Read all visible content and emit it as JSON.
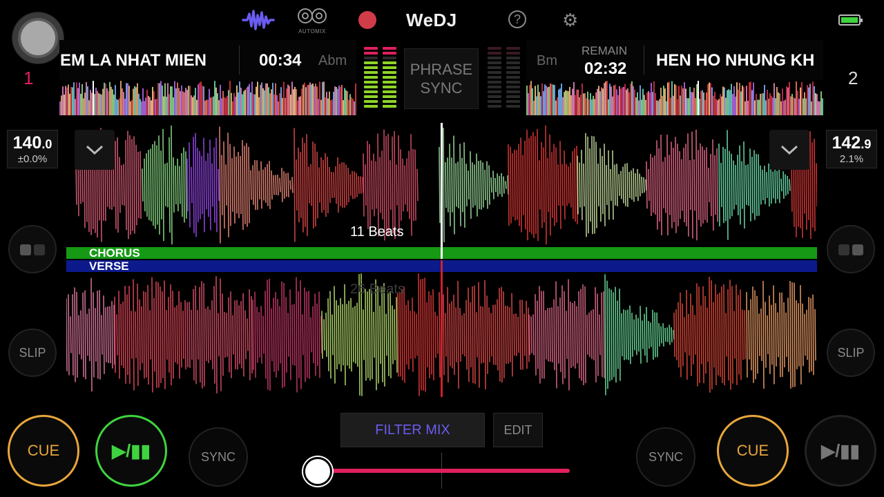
{
  "app": {
    "logo": "WeDJ",
    "automix_label": "AUTOMIX",
    "help_glyph": "?"
  },
  "icons": {
    "waveform": "waveform-icon",
    "automix": "automix-icon",
    "record": "record-icon",
    "help": "help-icon",
    "settings": "gear-icon",
    "battery": "battery-icon",
    "chevron": "chevron-down-icon",
    "split": "split-view-icon"
  },
  "colors": {
    "accent_purple": "#6a5cf0",
    "deck_one": "#e0205c",
    "cue": "#e8a63c",
    "play": "#3fd340",
    "chorus": "#169a16",
    "verse": "#0d1a8c",
    "record": "#d03c48"
  },
  "deck1": {
    "number": "1",
    "title": "EM LA NHAT MIEN",
    "time": "00:34",
    "key": "Abm",
    "bpm_int": "140",
    "bpm_dec": ".0",
    "pitch": "±0.0%",
    "beats": "11 Beats",
    "slip": "SLIP",
    "cue": "CUE",
    "play": "▶/▮▮",
    "sync": "SYNC"
  },
  "deck2": {
    "number": "2",
    "title": "HEN HO NHUNG KH",
    "remain_label": "REMAIN",
    "time": "02:32",
    "key": "Bm",
    "bpm_int": "142",
    "bpm_dec": ".9",
    "pitch": "2.1%",
    "beats": "26 Beats",
    "slip": "SLIP",
    "cue": "CUE",
    "play": "▶/▮▮",
    "sync": "SYNC"
  },
  "phrase_sync": {
    "line1": "PHRASE",
    "line2": "SYNC"
  },
  "phrases": {
    "deck1": "CHORUS",
    "deck2": "VERSE"
  },
  "mixer": {
    "filter_mix": "FILTER MIX",
    "edit": "EDIT",
    "crossfader_position": 0.0
  }
}
